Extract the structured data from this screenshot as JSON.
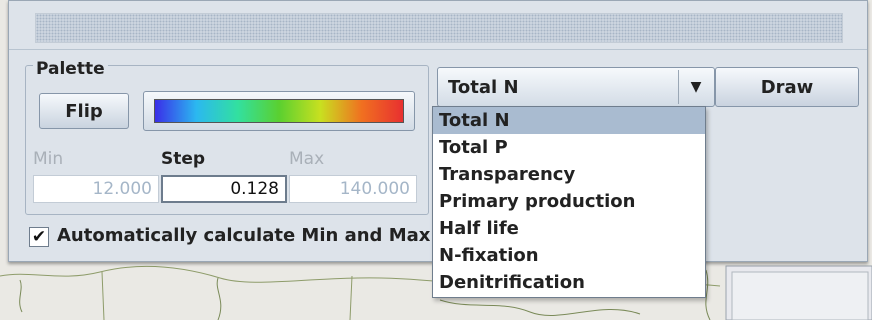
{
  "palette": {
    "title": "Palette",
    "flip_label": "Flip",
    "gradient_colors": [
      "#3a2ee8",
      "#2bb8f0",
      "#32e0a0",
      "#5ad030",
      "#c8e020",
      "#f07020",
      "#e83030"
    ],
    "min_label": "Min",
    "step_label": "Step",
    "max_label": "Max",
    "min_value": "12.000",
    "step_value": "0.128",
    "max_value": "140.000"
  },
  "auto_calc": {
    "checked": true,
    "check_mark": "✔",
    "label": "Automatically calculate Min and Max v"
  },
  "variable_select": {
    "selected": "Total N",
    "arrow_icon": "▼",
    "options": [
      "Total N",
      "Total P",
      "Transparency",
      "Primary production",
      "Half life",
      "N-fixation",
      "Denitrification"
    ]
  },
  "draw_label": "Draw"
}
